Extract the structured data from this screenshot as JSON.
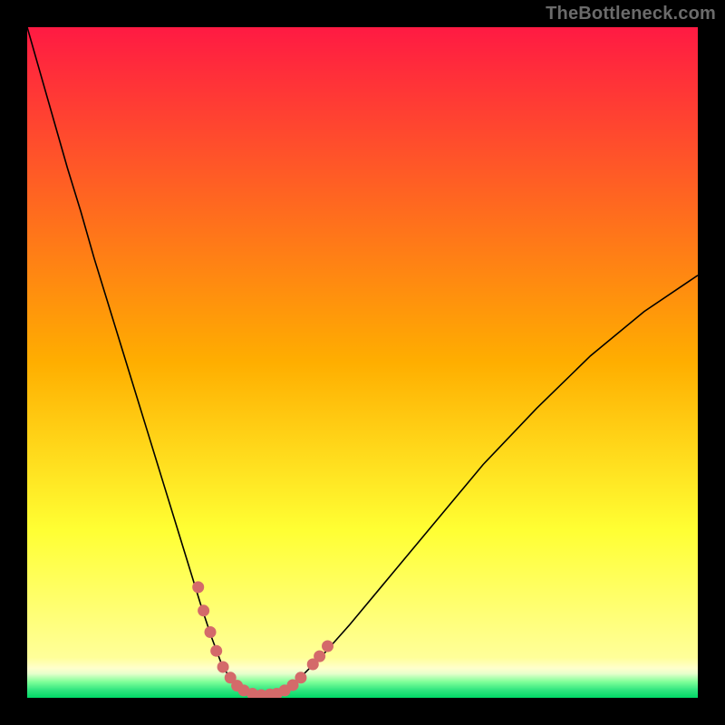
{
  "watermark": "TheBottleneck.com",
  "chart_data": {
    "type": "line",
    "title": "",
    "xlabel": "",
    "ylabel": "",
    "xlim": [
      0,
      100
    ],
    "ylim": [
      0,
      100
    ],
    "grid": false,
    "background_gradient": {
      "stops": [
        {
          "offset": 0.0,
          "color": "#ff1a43"
        },
        {
          "offset": 0.5,
          "color": "#ffae00"
        },
        {
          "offset": 0.75,
          "color": "#ffff33"
        },
        {
          "offset": 0.94,
          "color": "#ffff99"
        },
        {
          "offset": 0.956,
          "color": "#ffffcc"
        },
        {
          "offset": 0.964,
          "color": "#e6ffcc"
        },
        {
          "offset": 0.976,
          "color": "#80ff99"
        },
        {
          "offset": 0.988,
          "color": "#33e680"
        },
        {
          "offset": 1.0,
          "color": "#00d966"
        }
      ]
    },
    "series": [
      {
        "name": "bottleneck-curve",
        "stroke": "#000000",
        "stroke_width": 1.6,
        "x": [
          0.0,
          2.0,
          4.0,
          6.0,
          8.0,
          10.0,
          12.0,
          14.0,
          16.0,
          18.0,
          20.0,
          22.0,
          24.0,
          26.0,
          27.5,
          29.0,
          30.5,
          32.0,
          33.5,
          35.0,
          37.0,
          39.0,
          41.0,
          44.0,
          48.0,
          53.0,
          60.0,
          68.0,
          76.0,
          84.0,
          92.0,
          100.0
        ],
        "y": [
          100.0,
          93.0,
          86.0,
          79.0,
          72.5,
          65.5,
          59.0,
          52.5,
          46.0,
          39.5,
          33.0,
          26.5,
          20.0,
          13.5,
          9.0,
          5.0,
          2.5,
          1.2,
          0.6,
          0.4,
          0.6,
          1.6,
          3.3,
          6.3,
          10.8,
          16.8,
          25.2,
          34.8,
          43.2,
          51.0,
          57.6,
          63.0
        ]
      }
    ],
    "markers": [
      {
        "name": "highlight-left",
        "color": "#d46a6a",
        "size": 13,
        "points": [
          {
            "x": 25.5,
            "y": 16.5
          },
          {
            "x": 26.3,
            "y": 13.0
          },
          {
            "x": 27.3,
            "y": 9.8
          },
          {
            "x": 28.2,
            "y": 7.0
          },
          {
            "x": 29.2,
            "y": 4.6
          },
          {
            "x": 30.3,
            "y": 3.0
          },
          {
            "x": 31.3,
            "y": 1.8
          },
          {
            "x": 32.3,
            "y": 1.1
          },
          {
            "x": 33.6,
            "y": 0.6
          },
          {
            "x": 34.9,
            "y": 0.4
          },
          {
            "x": 36.2,
            "y": 0.5
          }
        ]
      },
      {
        "name": "highlight-right",
        "color": "#d46a6a",
        "size": 13,
        "points": [
          {
            "x": 37.2,
            "y": 0.6
          },
          {
            "x": 38.4,
            "y": 1.1
          },
          {
            "x": 39.6,
            "y": 1.9
          },
          {
            "x": 40.8,
            "y": 3.0
          },
          {
            "x": 42.6,
            "y": 5.0
          },
          {
            "x": 43.6,
            "y": 6.2
          },
          {
            "x": 44.8,
            "y": 7.7
          }
        ]
      }
    ]
  }
}
